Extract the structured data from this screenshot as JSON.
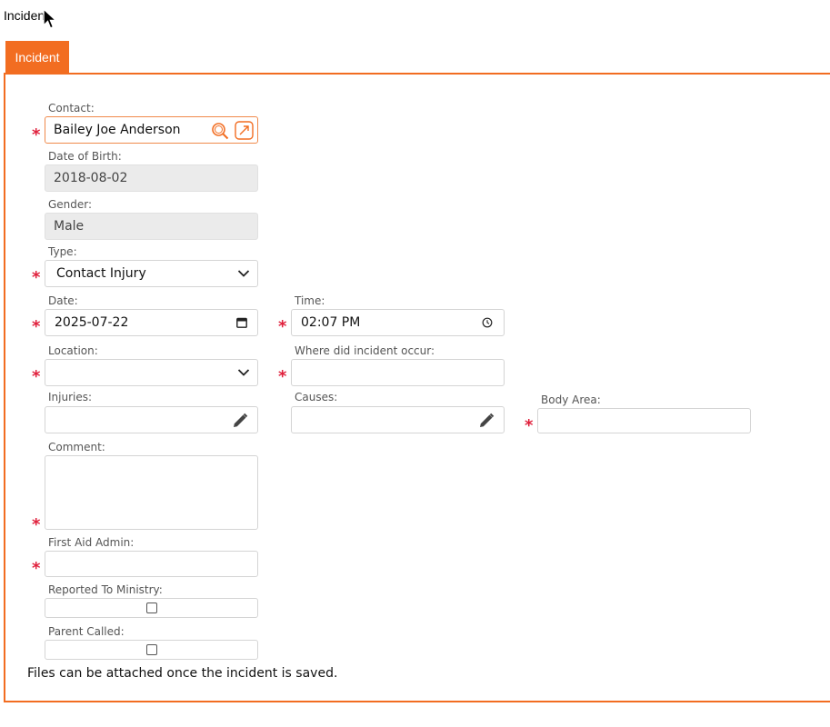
{
  "page": {
    "title": "Incident"
  },
  "tabs": [
    {
      "label": "Incident",
      "active": true
    }
  ],
  "form": {
    "contact": {
      "label": "Contact:",
      "value": "Bailey Joe Anderson"
    },
    "dob": {
      "label": "Date of Birth:",
      "value": "2018-08-02"
    },
    "gender": {
      "label": "Gender:",
      "value": "Male"
    },
    "type": {
      "label": "Type:",
      "value": "Contact Injury"
    },
    "date": {
      "label": "Date:",
      "value": "2025-07-22"
    },
    "time": {
      "label": "Time:",
      "value": "02:07 PM"
    },
    "location": {
      "label": "Location:",
      "value": ""
    },
    "where": {
      "label": "Where did incident occur:",
      "value": ""
    },
    "injuries": {
      "label": "Injuries:",
      "value": ""
    },
    "causes": {
      "label": "Causes:",
      "value": ""
    },
    "body_area": {
      "label": "Body Area:",
      "value": ""
    },
    "comment": {
      "label": "Comment:",
      "value": ""
    },
    "first_aid": {
      "label": "First Aid Admin:",
      "value": ""
    },
    "reported": {
      "label": "Reported To Ministry:",
      "checked": false
    },
    "parent_called": {
      "label": "Parent Called:",
      "checked": false
    }
  },
  "footer_note": "Files can be attached once the incident is saved.",
  "colors": {
    "accent": "#f26d21",
    "required": "#e0203c",
    "readonly_bg": "#ebebeb"
  },
  "icons": [
    "search-icon",
    "open-link-icon",
    "chevron-down-icon",
    "calendar-icon",
    "clock-icon",
    "pencil-icon"
  ]
}
